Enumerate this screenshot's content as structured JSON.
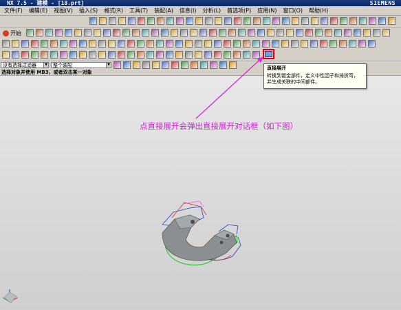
{
  "window": {
    "title": "NX 7.5 - 建模 - [18.prt]",
    "brand": "SIEMENS"
  },
  "menu": {
    "items": [
      "文件(F)",
      "编辑(E)",
      "视图(V)",
      "插入(S)",
      "格式(R)",
      "工具(T)",
      "装配(A)",
      "信息(I)",
      "分析(L)",
      "首选项(P)",
      "应用(N)",
      "窗口(O)",
      "帮助(H)"
    ]
  },
  "toolbar": {
    "start_label": "开始",
    "highlighted_tool": "unfold-direct-icon"
  },
  "filterbar": {
    "type_filter_value": "没有选择过滤器",
    "scope_filter_value": "整个装配"
  },
  "statusbar": {
    "prompt": "选择对象并使用 MB3，或者双击某一对象"
  },
  "tooltip": {
    "title": "直接展开",
    "body_line1": "转换到钣金部件，定义中性因子和排折弯，",
    "body_line2": "并生成关联的中间部件。"
  },
  "annotation": {
    "text": "点直接展开会弹出直接展开对话框（如下图）",
    "color": "#cc22cc"
  },
  "colors": {
    "highlight_box": "#e00010",
    "part_body": "#8c8f92"
  }
}
